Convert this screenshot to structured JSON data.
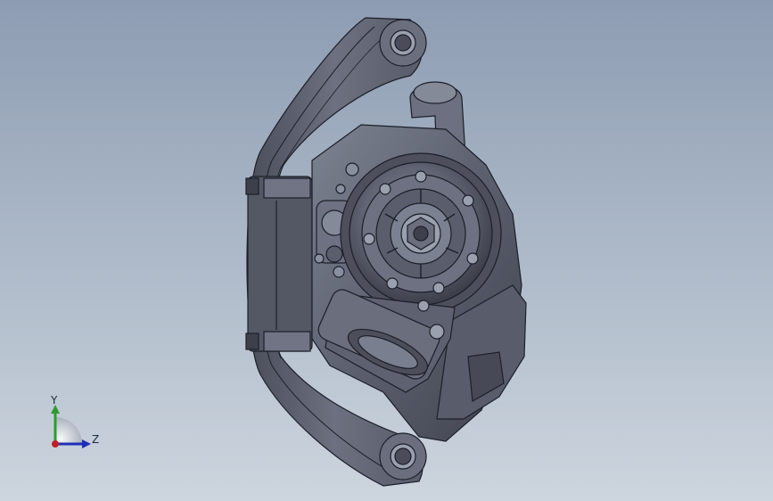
{
  "viewport": {
    "background_top": "#8d9cb2",
    "background_bottom": "#cdd5de"
  },
  "model": {
    "description_icon": "brake-caliper-assembly",
    "body_color": "#5d6170",
    "edge_color": "#1c1f28"
  },
  "triad": {
    "y_label": "Y",
    "z_label": "Z",
    "y_color": "#2e9b2e",
    "z_color": "#1f2fb8",
    "x_color": "#c02020"
  }
}
